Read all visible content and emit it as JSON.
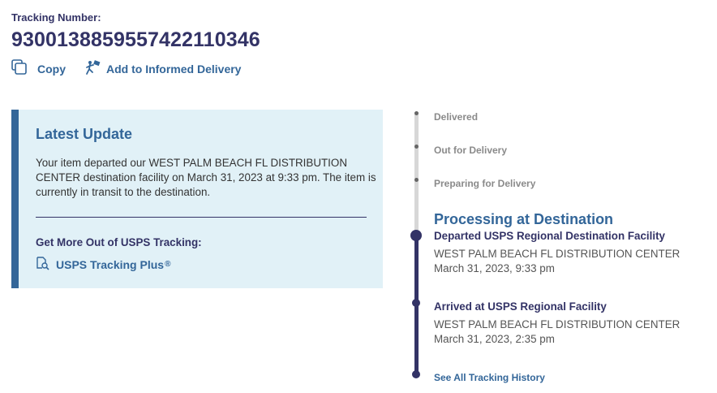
{
  "tracking": {
    "label": "Tracking Number:",
    "number": "9300138859557422110346"
  },
  "actions": {
    "copy_label": "Copy",
    "informed_label": "Add to Informed Delivery"
  },
  "latest_update": {
    "title": "Latest Update",
    "text": "Your item departed our WEST PALM BEACH FL DISTRIBUTION CENTER destination facility on March 31, 2023 at 9:33 pm. The item is currently in transit to the destination.",
    "more_label": "Get More Out of USPS Tracking:",
    "plus_label": "USPS Tracking Plus",
    "plus_mark": "®"
  },
  "timeline": {
    "steps": [
      "Delivered",
      "Out for Delivery",
      "Preparing for Delivery"
    ],
    "current_status": "Processing at Destination",
    "events": [
      {
        "title": "Departed USPS Regional Destination Facility",
        "location": "WEST PALM BEACH FL DISTRIBUTION CENTER",
        "date": "March 31, 2023, 9:33 pm"
      },
      {
        "title": "Arrived at USPS Regional Facility",
        "location": "WEST PALM BEACH FL DISTRIBUTION CENTER",
        "date": "March 31, 2023, 2:35 pm"
      }
    ],
    "history_link": "See All Tracking History"
  },
  "colors": {
    "navy": "#333366",
    "blue": "#336699",
    "panel": "#e1f1f7",
    "grey": "#d7d7d7"
  },
  "icons": [
    "copy-icon",
    "informed-delivery-icon",
    "tracking-plus-icon"
  ]
}
